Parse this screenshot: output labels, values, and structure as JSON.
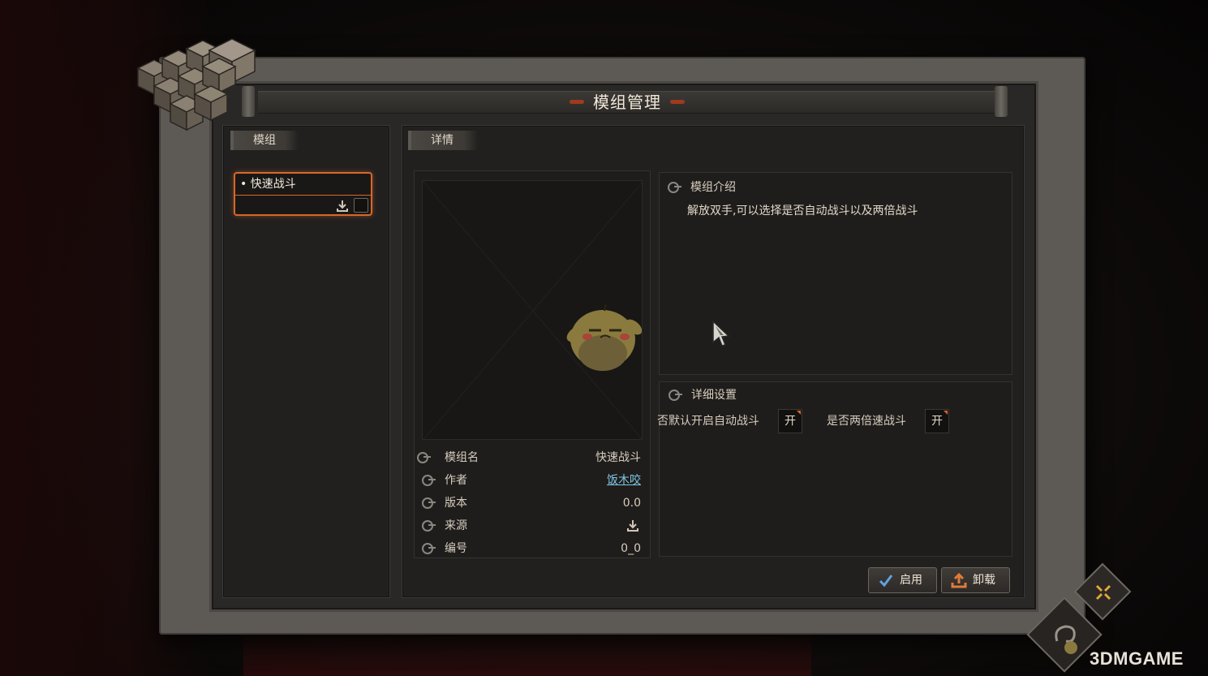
{
  "window": {
    "title": "模组管理"
  },
  "left_panel": {
    "tab_label": "模组",
    "mods": [
      {
        "name": "• 快速战斗",
        "selected": true
      }
    ]
  },
  "right_panel": {
    "tab_label": "详情",
    "info": {
      "rows": [
        {
          "key": "模组名",
          "value": "快速战斗"
        },
        {
          "key": "作者",
          "value": "饭木咬"
        },
        {
          "key": "版本",
          "value": "0.0"
        },
        {
          "key": "来源",
          "value": ""
        },
        {
          "key": "编号",
          "value": "0_0"
        }
      ]
    },
    "intro": {
      "header": "模组介绍",
      "text": "解放双手,可以选择是否自动战斗以及两倍战斗"
    },
    "settings": {
      "header": "详细设置",
      "items": [
        {
          "label": "否默认开启自动战斗",
          "value": "开"
        },
        {
          "label": "是否两倍速战斗",
          "value": "开"
        }
      ]
    }
  },
  "actions": {
    "enable_label": "启用",
    "unload_label": "卸载"
  },
  "watermark": "3DMGAME",
  "colors": {
    "accent": "#d7672c",
    "link": "#7fc6e6",
    "panel_bg": "#22201f",
    "frame": "#5d5a55"
  },
  "icons": {
    "download": "download-icon",
    "check": "check-icon",
    "upload": "upload-icon",
    "close": "close-icon",
    "bullet": "gear-bullet-icon"
  }
}
